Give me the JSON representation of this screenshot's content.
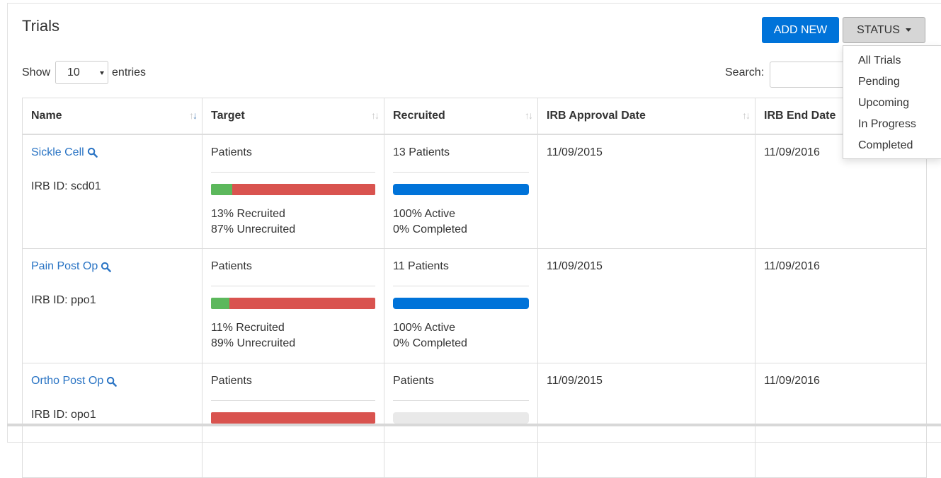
{
  "header": {
    "title": "Trials",
    "add_new_label": "ADD NEW",
    "status_label": "STATUS"
  },
  "status_menu": {
    "items": [
      "All Trials",
      "Pending",
      "Upcoming",
      "In Progress",
      "Completed"
    ]
  },
  "controls": {
    "show_label": "Show",
    "entries_value": "10",
    "entries_label": "entries",
    "search_label": "Search:",
    "search_value": ""
  },
  "table": {
    "columns": [
      "Name",
      "Target",
      "Recruited",
      "IRB Approval Date",
      "IRB End Date"
    ],
    "rows": [
      {
        "name": "Sickle Cell",
        "irb_id": "IRB ID: scd01",
        "target": "Patients",
        "recruited_fraction": 0.13,
        "recruited_text": "13% Recruited",
        "unrecruited_text": "87% Unrecruited",
        "recruited": "13 Patients",
        "active_fraction": 1.0,
        "active_text": "100% Active",
        "completed_text": "0% Completed",
        "irb_approval_date": "11/09/2015",
        "irb_end_date": "11/09/2016"
      },
      {
        "name": "Pain Post Op",
        "irb_id": "IRB ID: ppo1",
        "target": "Patients",
        "recruited_fraction": 0.11,
        "recruited_text": "11% Recruited",
        "unrecruited_text": "89% Unrecruited",
        "recruited": "11 Patients",
        "active_fraction": 1.0,
        "active_text": "100% Active",
        "completed_text": "0% Completed",
        "irb_approval_date": "11/09/2015",
        "irb_end_date": "11/09/2016"
      },
      {
        "name": "Ortho Post Op",
        "irb_id": "IRB ID: opo1",
        "target": "Patients",
        "recruited_fraction": 0.0,
        "recruited": "Patients",
        "active_fraction": 0.0,
        "irb_approval_date": "11/09/2015",
        "irb_end_date": "11/09/2016"
      }
    ]
  },
  "colors": {
    "primary": "#0073d9",
    "recruited": "#5cb85c",
    "unrecruited": "#d9534f",
    "link": "#2a74c4"
  }
}
